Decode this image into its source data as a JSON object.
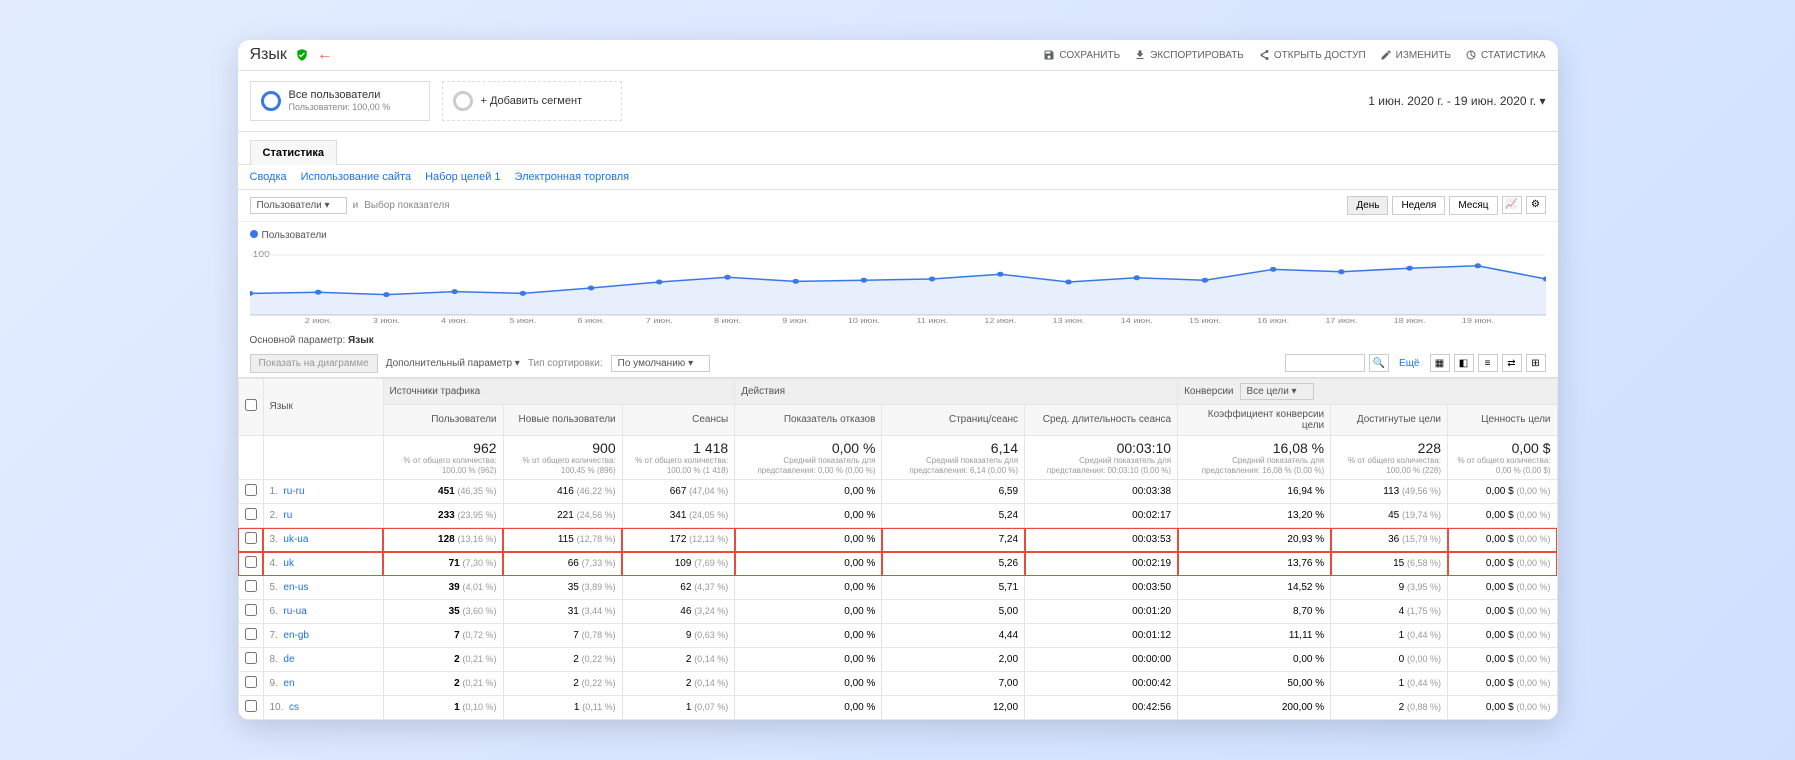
{
  "header": {
    "title": "Язык",
    "actions": {
      "save": "СОХРАНИТЬ",
      "export": "ЭКСПОРТИРОВАТЬ",
      "share": "ОТКРЫТЬ ДОСТУП",
      "edit": "ИЗМЕНИТЬ",
      "stats": "СТАТИСТИКА"
    }
  },
  "segments": {
    "all_users": "Все пользователи",
    "all_users_sub": "Пользователи: 100,00 %",
    "add_segment": "+ Добавить сегмент",
    "date_range": "1 июн. 2020 г. - 19 июн. 2020 г."
  },
  "stats_label": "Статистика",
  "tabs": {
    "summary": "Сводка",
    "usage": "Использование сайта",
    "goals": "Набор целей 1",
    "ecom": "Электронная торговля"
  },
  "chart_controls": {
    "metric": "Пользователи",
    "and": "и",
    "compare": "Выбор показателя",
    "day": "День",
    "week": "Неделя",
    "month": "Месяц"
  },
  "legend_label": "Пользователи",
  "y_tick": "100",
  "primary_param": "Основной параметр:",
  "primary_param_val": "Язык",
  "filters": {
    "show_chart": "Показать на диаграмме",
    "secondary": "Дополнительный параметр",
    "sort_type": "Тип сортировки:",
    "sort_default": "По умолчанию",
    "more": "Ещё"
  },
  "table": {
    "col_lang": "Язык",
    "group_traffic": "Источники трафика",
    "group_behavior": "Действия",
    "group_conversions": "Конверсии",
    "goal_select": "Все цели",
    "col_users": "Пользователи",
    "col_new_users": "Новые пользователи",
    "col_sessions": "Сеансы",
    "col_bounce": "Показатель отказов",
    "col_pages": "Страниц/сеанс",
    "col_duration": "Сред. длительность сеанса",
    "col_conv_rate": "Коэффициент конверсии цели",
    "col_completions": "Достигнутые цели",
    "col_value": "Ценность цели",
    "totals": {
      "users": "962",
      "users_sub": "% от общего количества: 100,00 % (962)",
      "new_users": "900",
      "new_users_sub": "% от общего количества: 100,45 % (896)",
      "sessions": "1 418",
      "sessions_sub": "% от общего количества: 100,00 % (1 418)",
      "bounce": "0,00 %",
      "bounce_sub": "Средний показатель для представления: 0,00 % (0,00 %)",
      "pages": "6,14",
      "pages_sub": "Средний показатель для представления: 6,14 (0,00 %)",
      "duration": "00:03:10",
      "duration_sub": "Средний показатель для представления: 00:03:10 (0,00 %)",
      "conv_rate": "16,08 %",
      "conv_rate_sub": "Средний показатель для представления: 16,08 % (0,00 %)",
      "completions": "228",
      "completions_sub": "% от общего количества: 100,00 % (228)",
      "value": "0,00 $",
      "value_sub": "% от общего количества: 0,00 % (0,00 $)"
    },
    "rows": [
      {
        "n": "1.",
        "lang": "ru-ru",
        "users": "451",
        "users_p": "(46,35 %)",
        "new": "416",
        "new_p": "(46,22 %)",
        "sess": "667",
        "sess_p": "(47,04 %)",
        "bounce": "0,00 %",
        "pages": "6,59",
        "dur": "00:03:38",
        "conv": "16,94 %",
        "compl": "113",
        "compl_p": "(49,56 %)",
        "val": "0,00 $",
        "val_p": "(0,00 %)",
        "hl": false
      },
      {
        "n": "2.",
        "lang": "ru",
        "users": "233",
        "users_p": "(23,95 %)",
        "new": "221",
        "new_p": "(24,56 %)",
        "sess": "341",
        "sess_p": "(24,05 %)",
        "bounce": "0,00 %",
        "pages": "5,24",
        "dur": "00:02:17",
        "conv": "13,20 %",
        "compl": "45",
        "compl_p": "(19,74 %)",
        "val": "0,00 $",
        "val_p": "(0,00 %)",
        "hl": false
      },
      {
        "n": "3.",
        "lang": "uk-ua",
        "users": "128",
        "users_p": "(13,16 %)",
        "new": "115",
        "new_p": "(12,78 %)",
        "sess": "172",
        "sess_p": "(12,13 %)",
        "bounce": "0,00 %",
        "pages": "7,24",
        "dur": "00:03:53",
        "conv": "20,93 %",
        "compl": "36",
        "compl_p": "(15,79 %)",
        "val": "0,00 $",
        "val_p": "(0,00 %)",
        "hl": true
      },
      {
        "n": "4.",
        "lang": "uk",
        "users": "71",
        "users_p": "(7,30 %)",
        "new": "66",
        "new_p": "(7,33 %)",
        "sess": "109",
        "sess_p": "(7,69 %)",
        "bounce": "0,00 %",
        "pages": "5,26",
        "dur": "00:02:19",
        "conv": "13,76 %",
        "compl": "15",
        "compl_p": "(6,58 %)",
        "val": "0,00 $",
        "val_p": "(0,00 %)",
        "hl": true
      },
      {
        "n": "5.",
        "lang": "en-us",
        "users": "39",
        "users_p": "(4,01 %)",
        "new": "35",
        "new_p": "(3,89 %)",
        "sess": "62",
        "sess_p": "(4,37 %)",
        "bounce": "0,00 %",
        "pages": "5,71",
        "dur": "00:03:50",
        "conv": "14,52 %",
        "compl": "9",
        "compl_p": "(3,95 %)",
        "val": "0,00 $",
        "val_p": "(0,00 %)",
        "hl": false
      },
      {
        "n": "6.",
        "lang": "ru-ua",
        "users": "35",
        "users_p": "(3,60 %)",
        "new": "31",
        "new_p": "(3,44 %)",
        "sess": "46",
        "sess_p": "(3,24 %)",
        "bounce": "0,00 %",
        "pages": "5,00",
        "dur": "00:01:20",
        "conv": "8,70 %",
        "compl": "4",
        "compl_p": "(1,75 %)",
        "val": "0,00 $",
        "val_p": "(0,00 %)",
        "hl": false
      },
      {
        "n": "7.",
        "lang": "en-gb",
        "users": "7",
        "users_p": "(0,72 %)",
        "new": "7",
        "new_p": "(0,78 %)",
        "sess": "9",
        "sess_p": "(0,63 %)",
        "bounce": "0,00 %",
        "pages": "4,44",
        "dur": "00:01:12",
        "conv": "11,11 %",
        "compl": "1",
        "compl_p": "(0,44 %)",
        "val": "0,00 $",
        "val_p": "(0,00 %)",
        "hl": false
      },
      {
        "n": "8.",
        "lang": "de",
        "users": "2",
        "users_p": "(0,21 %)",
        "new": "2",
        "new_p": "(0,22 %)",
        "sess": "2",
        "sess_p": "(0,14 %)",
        "bounce": "0,00 %",
        "pages": "2,00",
        "dur": "00:00:00",
        "conv": "0,00 %",
        "compl": "0",
        "compl_p": "(0,00 %)",
        "val": "0,00 $",
        "val_p": "(0,00 %)",
        "hl": false
      },
      {
        "n": "9.",
        "lang": "en",
        "users": "2",
        "users_p": "(0,21 %)",
        "new": "2",
        "new_p": "(0,22 %)",
        "sess": "2",
        "sess_p": "(0,14 %)",
        "bounce": "0,00 %",
        "pages": "7,00",
        "dur": "00:00:42",
        "conv": "50,00 %",
        "compl": "1",
        "compl_p": "(0,44 %)",
        "val": "0,00 $",
        "val_p": "(0,00 %)",
        "hl": false
      },
      {
        "n": "10.",
        "lang": "cs",
        "users": "1",
        "users_p": "(0,10 %)",
        "new": "1",
        "new_p": "(0,11 %)",
        "sess": "1",
        "sess_p": "(0,07 %)",
        "bounce": "0,00 %",
        "pages": "12,00",
        "dur": "00:42:56",
        "conv": "200,00 %",
        "compl": "2",
        "compl_p": "(0,88 %)",
        "val": "0,00 $",
        "val_p": "(0,00 %)",
        "hl": false
      }
    ]
  },
  "chart_data": {
    "type": "line",
    "title": "Пользователи",
    "xlabel": "",
    "ylabel": "",
    "ylim": [
      0,
      100
    ],
    "categories": [
      "2 июн.",
      "3 июн.",
      "4 июн.",
      "5 июн.",
      "6 июн.",
      "7 июн.",
      "8 июн.",
      "9 июн.",
      "10 июн.",
      "11 июн.",
      "12 июн.",
      "13 июн.",
      "14 июн.",
      "15 июн.",
      "16 июн.",
      "17 июн.",
      "18 июн.",
      "19 июн."
    ],
    "values": [
      36,
      38,
      34,
      39,
      36,
      45,
      55,
      63,
      56,
      58,
      60,
      68,
      55,
      62,
      58,
      76,
      72,
      78,
      82,
      60
    ]
  }
}
